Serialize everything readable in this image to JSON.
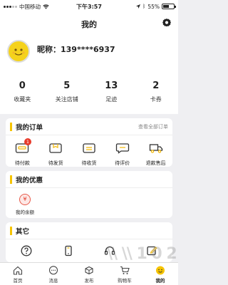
{
  "status_bar": {
    "carrier": "中国移动",
    "time": "下午3:57",
    "battery": "55%",
    "battery_level": 0.55
  },
  "header": {
    "title": "我的"
  },
  "profile": {
    "nickname": "昵称：139****6937"
  },
  "stats": [
    {
      "value": "0",
      "label": "收藏夹"
    },
    {
      "value": "5",
      "label": "关注店铺"
    },
    {
      "value": "13",
      "label": "足迹"
    },
    {
      "value": "2",
      "label": "卡券"
    }
  ],
  "orders": {
    "title": "我的订单",
    "view_all": "查看全部订单",
    "items": [
      {
        "label": "待付款",
        "badge": "1",
        "icon": "wallet-icon"
      },
      {
        "label": "待发货",
        "icon": "package-icon"
      },
      {
        "label": "待收货",
        "icon": "receive-icon"
      },
      {
        "label": "待评价",
        "icon": "comment-icon"
      },
      {
        "label": "退款售后",
        "icon": "truck-icon"
      }
    ]
  },
  "benefits": {
    "title": "我的优惠",
    "balance_label": "我的余额",
    "balance_symbol": "¥"
  },
  "others": {
    "title": "其它"
  },
  "tabbar": [
    {
      "label": "首页",
      "icon": "home-icon"
    },
    {
      "label": "消息",
      "icon": "message-icon"
    },
    {
      "label": "发布",
      "icon": "publish-icon"
    },
    {
      "label": "购物车",
      "icon": "cart-icon"
    },
    {
      "label": "我的",
      "icon": "profile-icon"
    }
  ],
  "watermark": "\\ \\ 1 0 2"
}
